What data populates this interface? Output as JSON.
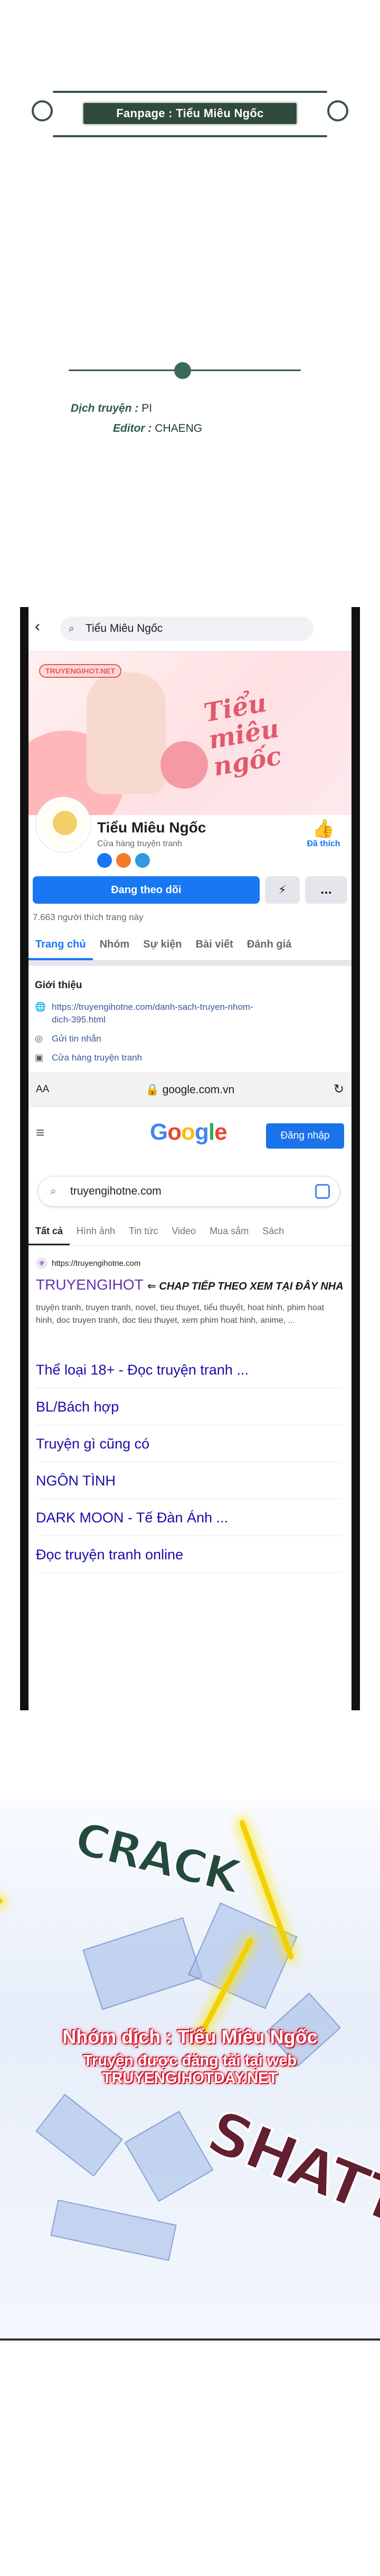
{
  "header": {
    "fanpage_label": "Fanpage : Tiểu Miêu Ngốc",
    "translator_label": "Dịch truyện :",
    "translator_name": "PI",
    "editor_label": "Editor :",
    "editor_name": "CHAENG"
  },
  "facebook": {
    "search_text": "Tiểu Miêu Ngốc",
    "cover_site": "TRUYENGIHOT.NET",
    "cover_title": "Tiểu miêu ngốc",
    "page_name": "Tiểu Miêu Ngốc",
    "page_category": "Cửa hàng truyện tranh",
    "liked_label": "Đã thích",
    "follow_label": "Đang theo dõi",
    "more_label": "...",
    "likes_count": "7.663 người thích trang này",
    "tabs": [
      "Trang chủ",
      "Nhóm",
      "Sự kiện",
      "Bài viết",
      "Đánh giá"
    ],
    "intro_title": "Giới thiệu",
    "intro_link": "https://truyengihotne.com/danh-sach-truyen-nhom-dich-395.html",
    "intro_link_line1": "https://truyengihotne.com/danh-sach-truyen-nhom-",
    "intro_link_line2": "dich-395.html",
    "intro_message": "Gửi tin nhắn",
    "intro_shop": "Cửa hàng truyện tranh"
  },
  "browser": {
    "aa_label": "AA",
    "url": "google.com.vn"
  },
  "google": {
    "logo": [
      "G",
      "o",
      "o",
      "g",
      "l",
      "e"
    ],
    "signin_label": "Đăng nhập",
    "query": "truyengihotne.com",
    "tabs": [
      "Tất cả",
      "Hình ảnh",
      "Tin tức",
      "Video",
      "Mua sắm",
      "Sách"
    ],
    "result_url": "https://truyengihotne.com",
    "result_title": "TRUYENGIHOT",
    "result_promo": "⇐ CHAP TIẾP THEO XEM TẠI ĐÂY NHA",
    "result_snippet": "truyện tranh, truyen tranh, novel, tieu thuyet, tiểu thuyết, hoat hinh, phim hoat hinh, doc truyen tranh, doc tieu thuyet, xem phim hoat hinh, anime, ...",
    "sitelinks": [
      "Thể loại 18+ - Đọc truyện tranh ...",
      "BL/Bách hợp",
      "Truyện gì cũng có",
      "NGÔN TÌNH",
      "DARK MOON - Tế Đàn Ánh ...",
      "Đọc truyện tranh online"
    ]
  },
  "panel": {
    "sfx_crack": "CRACK",
    "sfx_shatter": "SHATTER",
    "watermark_group": "Nhóm dịch : Tiểu Miêu Ngốc",
    "watermark_site": "Truyện được đăng tải tại web TRUYENGIHOTDAY.NET"
  },
  "colors": {
    "fb_blue": "#1877f2",
    "google_blue": "#1a73e8",
    "banner_green": "#304a3c",
    "watermark_red": "#e01f33"
  }
}
